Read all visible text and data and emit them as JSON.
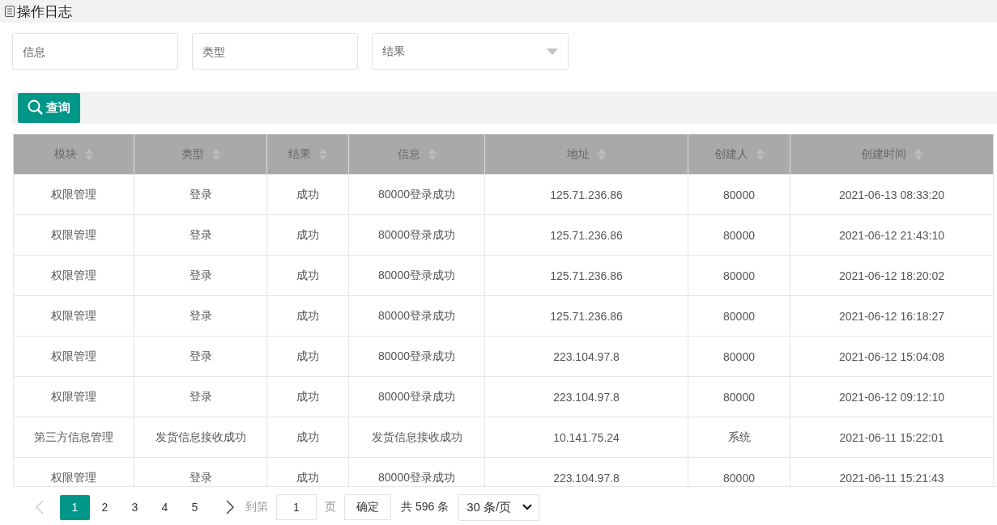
{
  "title": "操作日志",
  "filters": [
    {
      "kind": "input",
      "placeholder": "信息"
    },
    {
      "kind": "input",
      "placeholder": "类型"
    },
    {
      "kind": "select",
      "placeholder": "结果"
    }
  ],
  "search_button": "查询",
  "table": {
    "columns": [
      "模块",
      "类型",
      "结果",
      "信息",
      "地址",
      "创建人",
      "创建时间"
    ],
    "rows": [
      [
        "权限管理",
        "登录",
        "成功",
        "80000登录成功",
        "125.71.236.86",
        "80000",
        "2021-06-13 08:33:20"
      ],
      [
        "权限管理",
        "登录",
        "成功",
        "80000登录成功",
        "125.71.236.86",
        "80000",
        "2021-06-12 21:43:10"
      ],
      [
        "权限管理",
        "登录",
        "成功",
        "80000登录成功",
        "125.71.236.86",
        "80000",
        "2021-06-12 18:20:02"
      ],
      [
        "权限管理",
        "登录",
        "成功",
        "80000登录成功",
        "125.71.236.86",
        "80000",
        "2021-06-12 16:18:27"
      ],
      [
        "权限管理",
        "登录",
        "成功",
        "80000登录成功",
        "223.104.97.8",
        "80000",
        "2021-06-12 15:04:08"
      ],
      [
        "权限管理",
        "登录",
        "成功",
        "80000登录成功",
        "223.104.97.8",
        "80000",
        "2021-06-12 09:12:10"
      ],
      [
        "第三方信息管理",
        "发货信息接收成功",
        "成功",
        "发货信息接收成功",
        "10.141.75.24",
        "系统",
        "2021-06-11 15:22:01"
      ],
      [
        "权限管理",
        "登录",
        "成功",
        "80000登录成功",
        "223.104.97.8",
        "80000",
        "2021-06-11 15:21:43"
      ]
    ]
  },
  "pagination": {
    "pages": [
      {
        "label": "1",
        "selected": true
      },
      {
        "label": "2",
        "selected": false
      },
      {
        "label": "3",
        "selected": false
      },
      {
        "label": "4",
        "selected": false
      },
      {
        "label": "5",
        "selected": false
      }
    ],
    "goto_label": "到第",
    "goto_value": "1",
    "page_unit": "页",
    "confirm": "确定",
    "total": "共 596 条",
    "page_size": "30 条/页"
  }
}
